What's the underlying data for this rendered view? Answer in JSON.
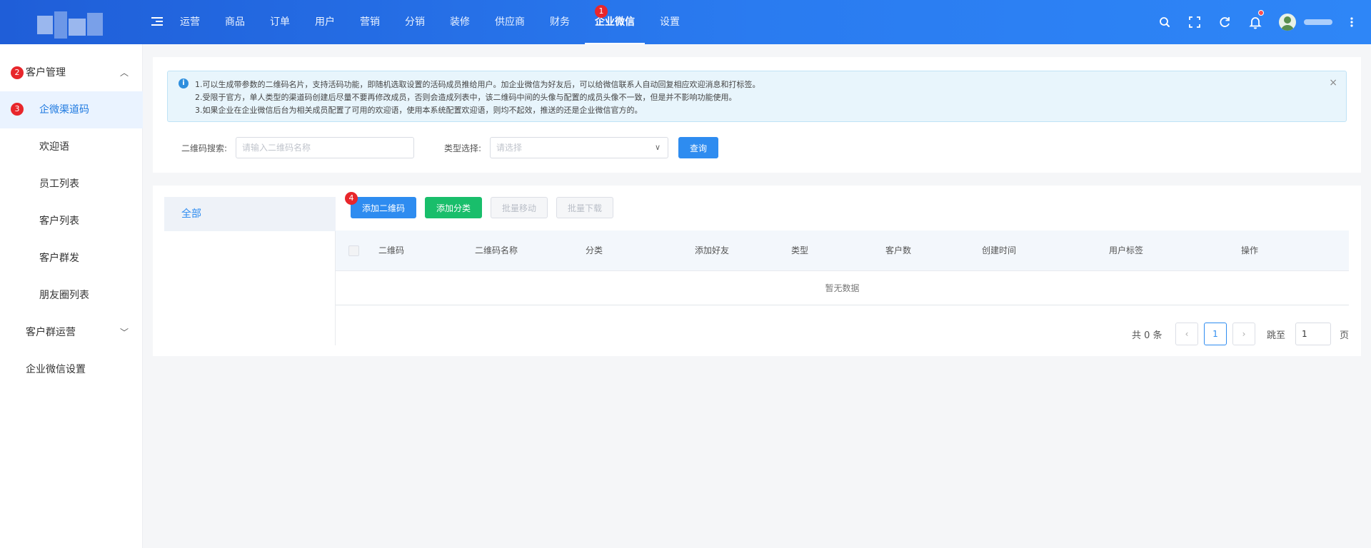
{
  "header": {
    "nav": [
      "运营",
      "商品",
      "订单",
      "用户",
      "营销",
      "分销",
      "装修",
      "供应商",
      "财务",
      "企业微信",
      "设置"
    ],
    "active_nav": "企业微信",
    "icons": [
      "search-icon",
      "fullscreen-icon",
      "refresh-icon",
      "bell-icon",
      "avatar",
      "more-icon"
    ]
  },
  "badges": {
    "nav": "1",
    "customer": "2",
    "channel": "3",
    "add_qr": "4"
  },
  "sidebar": {
    "items": [
      {
        "label": "客户管理",
        "type": "group",
        "expanded": true
      },
      {
        "label": "企微渠道码",
        "type": "sub",
        "active": true
      },
      {
        "label": "欢迎语",
        "type": "sub"
      },
      {
        "label": "员工列表",
        "type": "sub"
      },
      {
        "label": "客户列表",
        "type": "sub"
      },
      {
        "label": "客户群发",
        "type": "sub"
      },
      {
        "label": "朋友圈列表",
        "type": "sub"
      },
      {
        "label": "客户群运营",
        "type": "group",
        "expanded": false
      },
      {
        "label": "企业微信设置",
        "type": "group"
      }
    ]
  },
  "notice": {
    "lines": [
      "1.可以生成带参数的二维码名片，支持活码功能，即随机选取设置的活码成员推给用户。加企业微信为好友后，可以给微信联系人自动回复相应欢迎消息和打标签。",
      "2.受限于官方，单人类型的渠道码创建后尽量不要再修改成员，否则会造成列表中，该二维码中间的头像与配置的成员头像不一致，但是并不影响功能使用。",
      "3.如果企业在企业微信后台为相关成员配置了可用的欢迎语，使用本系统配置欢迎语，则均不起效，推送的还是企业微信官方的。"
    ],
    "close": "×"
  },
  "filters": {
    "qr_search_label": "二维码搜索:",
    "qr_search_placeholder": "请输入二维码名称",
    "type_label": "类型选择:",
    "type_placeholder": "请选择",
    "query_button": "查询"
  },
  "categories": [
    "全部"
  ],
  "toolbar": {
    "add_qr": "添加二维码",
    "add_category": "添加分类",
    "batch_move": "批量移动",
    "batch_download": "批量下载"
  },
  "table": {
    "columns": [
      "二维码",
      "二维码名称",
      "分类",
      "添加好友",
      "类型",
      "客户数",
      "创建时间",
      "用户标签",
      "操作"
    ],
    "empty_text": "暂无数据"
  },
  "pagination": {
    "total_text": "共 0 条",
    "current_page": "1",
    "jump_label": "跳至",
    "jump_value": "1",
    "page_suffix": "页"
  },
  "colors": {
    "primary": "#2e8cf0",
    "success": "#19be6b",
    "badge": "#e8262b",
    "header_start": "#1f5ed8",
    "header_end": "#2e86f7"
  }
}
